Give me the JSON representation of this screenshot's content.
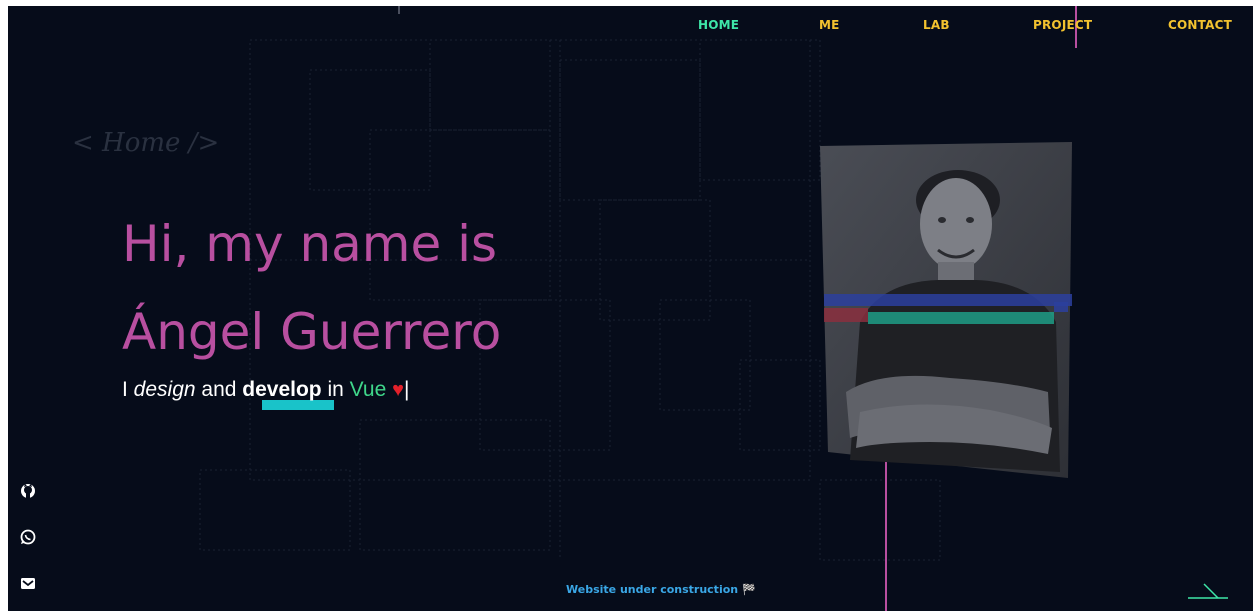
{
  "nav": {
    "items": [
      {
        "label": "HOME",
        "active": true
      },
      {
        "label": "ME",
        "active": false
      },
      {
        "label": "LAB",
        "active": false
      },
      {
        "label": "PROJECT",
        "active": false
      },
      {
        "label": "CONTACT",
        "active": false
      }
    ]
  },
  "hero": {
    "section_tag": "< Home />",
    "headline_line1": "Hi, my name is",
    "headline_line2": "Ángel Guerrero",
    "tagline": {
      "part1": "I ",
      "design": "design",
      "part2": " and ",
      "develop": "develop",
      "part3": " in ",
      "vue": "Vue",
      "heart": "♥",
      "cursor": "|"
    }
  },
  "social": {
    "items": [
      {
        "icon": "github-icon"
      },
      {
        "icon": "whatsapp-icon"
      },
      {
        "icon": "mail-icon"
      }
    ]
  },
  "footer": {
    "note": "Website under construction",
    "flag": "🏁"
  },
  "colors": {
    "background": "#060c1a",
    "nav_active": "#3ee6a8",
    "nav_default": "#f2c22f",
    "headline": "#b84fa0",
    "highlight": "#19c3c9",
    "vue": "#3fd68a",
    "heart": "#e3202a",
    "footer_note": "#3aa7e6"
  }
}
